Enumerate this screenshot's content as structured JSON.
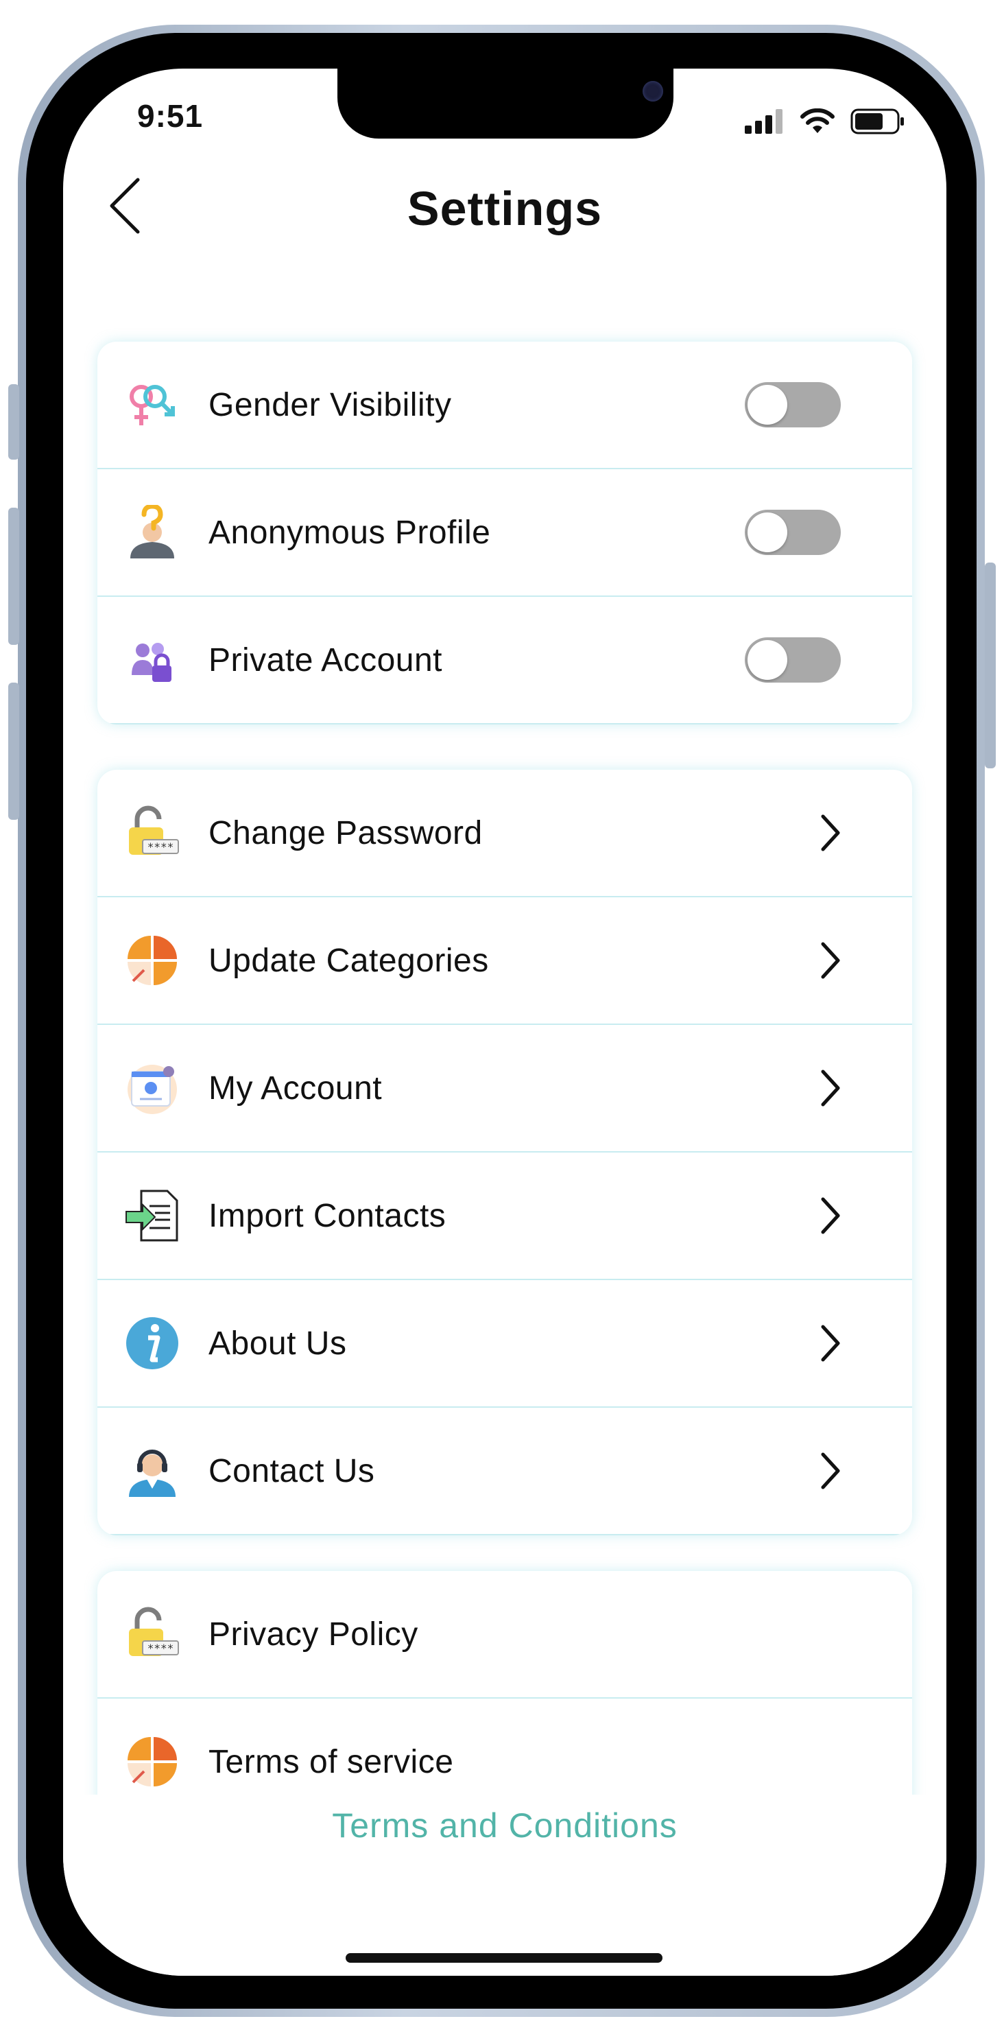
{
  "status_bar": {
    "time": "9:51"
  },
  "header": {
    "title": "Settings"
  },
  "toggle_section": [
    {
      "label": "Gender Visibility",
      "icon": "gender-icon",
      "on": false
    },
    {
      "label": "Anonymous Profile",
      "icon": "anonymous-user-icon",
      "on": false
    },
    {
      "label": "Private Account",
      "icon": "private-users-icon",
      "on": false
    }
  ],
  "nav_section": [
    {
      "label": "Change Password",
      "icon": "padlock-icon"
    },
    {
      "label": "Update Categories",
      "icon": "pie-categories-icon"
    },
    {
      "label": "My Account",
      "icon": "account-card-icon"
    },
    {
      "label": "Import Contacts",
      "icon": "import-document-icon"
    },
    {
      "label": "About Us",
      "icon": "info-icon"
    },
    {
      "label": "Contact Us",
      "icon": "support-agent-icon"
    }
  ],
  "legal_section": [
    {
      "label": "Privacy Policy",
      "icon": "padlock-icon"
    },
    {
      "label": "Terms of service",
      "icon": "pie-categories-icon"
    }
  ],
  "footer": {
    "terms_link": "Terms and Conditions"
  },
  "colors": {
    "accent": "#52b4a8",
    "toggle_off": "#a9a9a9",
    "divider": "#c8ecf0"
  }
}
